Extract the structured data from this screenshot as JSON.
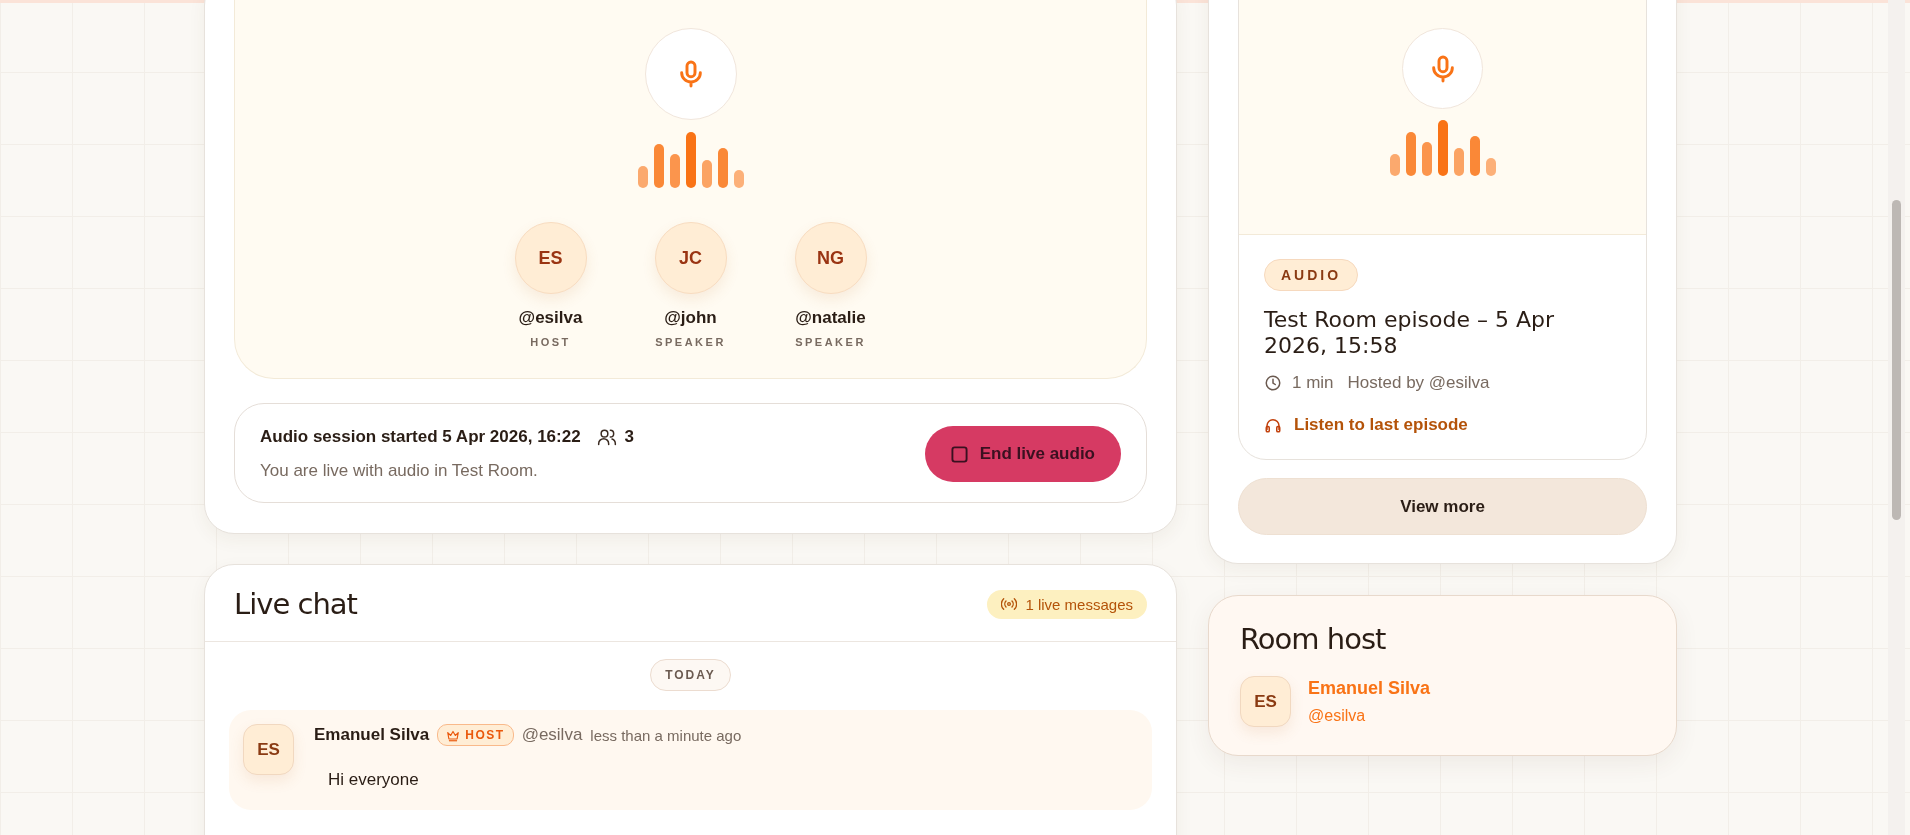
{
  "stage": {
    "participants": [
      {
        "initials": "ES",
        "handle": "@esilva",
        "role": "HOST"
      },
      {
        "initials": "JC",
        "handle": "@john",
        "role": "SPEAKER"
      },
      {
        "initials": "NG",
        "handle": "@natalie",
        "role": "SPEAKER"
      }
    ]
  },
  "session": {
    "title": "Audio session started 5 Apr 2026, 16:22",
    "listener_count": "3",
    "subtitle": "You are live with audio in Test Room.",
    "end_button": "End live audio"
  },
  "live_chat": {
    "title": "Live chat",
    "badge": "1 live messages",
    "date_divider": "TODAY",
    "messages": [
      {
        "initials": "ES",
        "name": "Emanuel Silva",
        "role_badge": "HOST",
        "handle": "@esilva",
        "time": "less than a minute ago",
        "text": "Hi everyone"
      }
    ]
  },
  "episode": {
    "tag": "AUDIO",
    "title": "Test Room episode – 5 Apr 2026, 15:58",
    "duration": "1 min",
    "host": "Hosted by @esilva",
    "listen_link": "Listen to last episode"
  },
  "view_more": "View more",
  "room_host": {
    "title": "Room host",
    "initials": "ES",
    "name": "Emanuel Silva",
    "handle": "@esilva"
  }
}
